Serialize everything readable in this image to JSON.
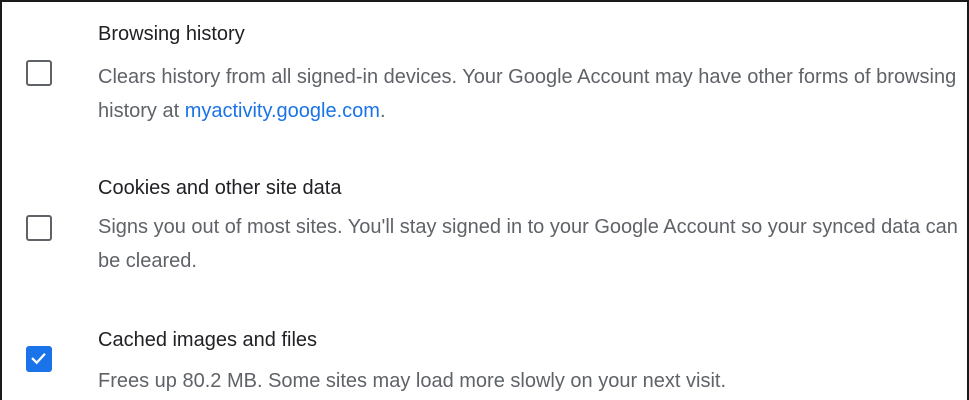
{
  "items": [
    {
      "title": "Browsing history",
      "description": "Clears history from all signed-in devices. Your Google Account may have other forms of browsing history at ",
      "link_text": "myactivity.google.com",
      "description_suffix": ".",
      "checked": false
    },
    {
      "title": "Cookies and other site data",
      "description": "Signs you out of most sites. You'll stay signed in to your Google Account so your synced data can be cleared.",
      "checked": false
    },
    {
      "title": "Cached images and files",
      "description": "Frees up 80.2 MB. Some sites may load more slowly on your next visit.",
      "checked": true
    }
  ],
  "colors": {
    "accent": "#1a73e8",
    "title_text": "#202124",
    "secondary_text": "#5f6368",
    "checkbox_border": "#5f6368"
  },
  "icons": {
    "checked": "checkmark-icon"
  }
}
